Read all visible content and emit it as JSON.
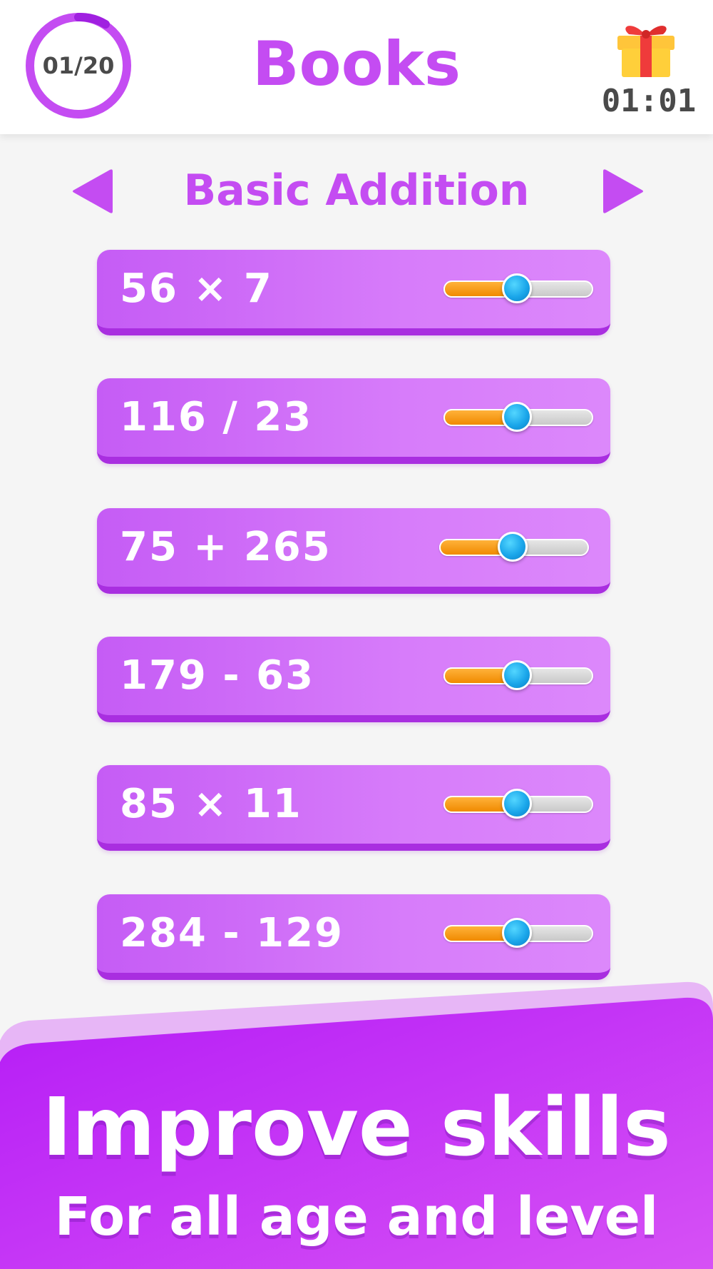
{
  "header": {
    "progress_label": "01/20",
    "progress_fraction": 0.05,
    "title": "Books",
    "timer": "01:01",
    "gift_icon": "gift-icon"
  },
  "category": {
    "label": "Basic Addition",
    "prev_icon": "arrow-left-icon",
    "next_icon": "arrow-right-icon"
  },
  "problems": [
    {
      "expression": "56 × 7",
      "level": 0.49
    },
    {
      "expression": "116 / 23",
      "level": 0.49
    },
    {
      "expression": "75 + 265",
      "level": 0.49
    },
    {
      "expression": "179 - 63",
      "level": 0.49
    },
    {
      "expression": "85 × 11",
      "level": 0.49
    },
    {
      "expression": "284 - 129",
      "level": 0.49
    }
  ],
  "banner": {
    "title": "Improve skills",
    "subtitle": "For all age and level"
  },
  "colors": {
    "accent": "#c44cf2",
    "card": "#d06cf8",
    "slider_fill": "#f5a01a",
    "slider_knob": "#1aa6ea",
    "banner": "#b823f7"
  }
}
